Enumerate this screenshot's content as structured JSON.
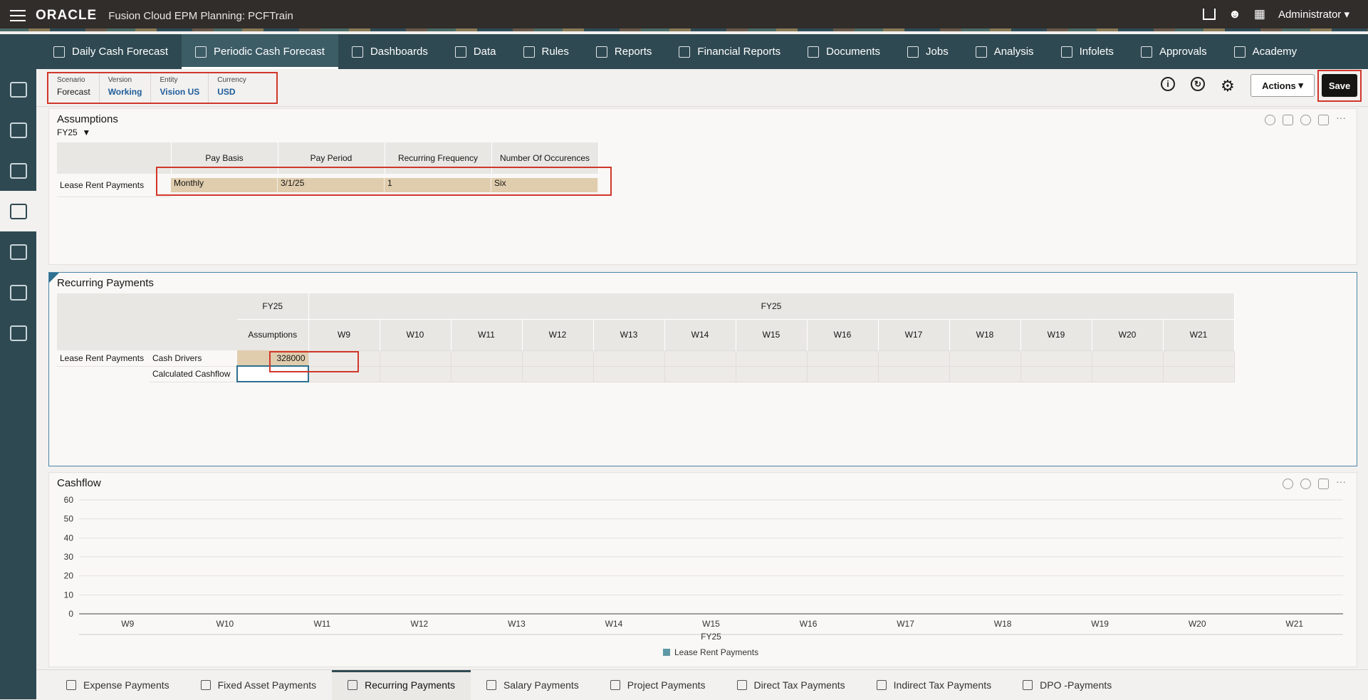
{
  "app": {
    "brand": "ORACLE",
    "title": "Fusion Cloud EPM Planning:  PCFTrain",
    "user": "Administrator"
  },
  "nav": [
    {
      "label": "Daily Cash Forecast",
      "icon": "dollar-clock-icon",
      "active": false
    },
    {
      "label": "Periodic Cash Forecast",
      "icon": "calendar-dollar-icon",
      "active": true
    },
    {
      "label": "Dashboards",
      "icon": "dashboard-icon",
      "active": false
    },
    {
      "label": "Data",
      "icon": "data-icon",
      "active": false
    },
    {
      "label": "Rules",
      "icon": "rules-icon",
      "active": false
    },
    {
      "label": "Reports",
      "icon": "reports-icon",
      "active": false
    },
    {
      "label": "Financial Reports",
      "icon": "financial-reports-icon",
      "active": false
    },
    {
      "label": "Documents",
      "icon": "documents-icon",
      "active": false
    },
    {
      "label": "Jobs",
      "icon": "jobs-icon",
      "active": false
    },
    {
      "label": "Analysis",
      "icon": "analysis-icon",
      "active": false
    },
    {
      "label": "Infolets",
      "icon": "infolets-icon",
      "active": false
    },
    {
      "label": "Approvals",
      "icon": "approvals-icon",
      "active": false
    },
    {
      "label": "Academy",
      "icon": "academy-icon",
      "active": false
    }
  ],
  "pov": [
    {
      "label": "Scenario",
      "value": "Forecast",
      "link": false
    },
    {
      "label": "Version",
      "value": "Working",
      "link": true
    },
    {
      "label": "Entity",
      "value": "Vision US",
      "link": true
    },
    {
      "label": "Currency",
      "value": "USD",
      "link": true
    }
  ],
  "toolbar": {
    "actions": "Actions",
    "save": "Save",
    "info": "i"
  },
  "assumptions": {
    "title": "Assumptions",
    "period": "FY25",
    "headers": [
      "Pay Basis",
      "Pay Period",
      "Recurring Frequency",
      "Number Of Occurences"
    ],
    "row_label": "Lease Rent Payments",
    "values": [
      "Monthly",
      "3/1/25",
      "1",
      "Six"
    ]
  },
  "recurring": {
    "title": "Recurring Payments",
    "fy_left": "FY25",
    "fy_right": "FY25",
    "col_assumptions": "Assumptions",
    "weeks": [
      "W9",
      "W10",
      "W11",
      "W12",
      "W13",
      "W14",
      "W15",
      "W16",
      "W17",
      "W18",
      "W19",
      "W20",
      "W21"
    ],
    "row_label": "Lease Rent Payments",
    "sub1": "Cash Drivers",
    "sub2": "Calculated Cashflow",
    "cash_driver_value": "328000"
  },
  "cashflow": {
    "title": "Cashflow"
  },
  "chart_data": {
    "type": "bar",
    "categories": [
      "W9",
      "W10",
      "W11",
      "W12",
      "W13",
      "W14",
      "W15",
      "W16",
      "W17",
      "W18",
      "W19",
      "W20",
      "W21"
    ],
    "series": [
      {
        "name": "Lease Rent Payments",
        "values": [
          0,
          0,
          0,
          0,
          0,
          0,
          0,
          0,
          0,
          0,
          0,
          0,
          0
        ]
      }
    ],
    "yticks": [
      "0",
      "10",
      "20",
      "30",
      "40",
      "50",
      "60"
    ],
    "ylim": [
      0,
      60
    ],
    "xlabel": "FY25",
    "legend": "bottom",
    "color": "#5f98a5"
  },
  "bottom_tabs": [
    {
      "label": "Expense Payments",
      "active": false
    },
    {
      "label": "Fixed Asset Payments",
      "active": false
    },
    {
      "label": "Recurring Payments",
      "active": true
    },
    {
      "label": "Salary Payments",
      "active": false
    },
    {
      "label": "Project Payments",
      "active": false
    },
    {
      "label": "Direct Tax Payments",
      "active": false
    },
    {
      "label": "Indirect Tax Payments",
      "active": false
    },
    {
      "label": "DPO -Payments",
      "active": false
    }
  ]
}
